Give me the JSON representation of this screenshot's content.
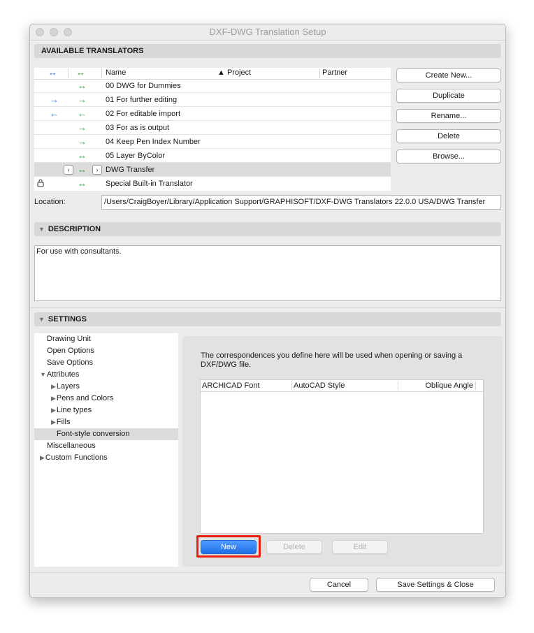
{
  "window": {
    "title": "DXF-DWG Translation Setup"
  },
  "available_translators": {
    "section_label": "AVAILABLE TRANSLATORS",
    "columns": {
      "direction1": "↔",
      "direction2": "↔",
      "name": "Name",
      "project": "▲ Project",
      "partner": "Partner"
    },
    "rows": [
      {
        "name": "00 DWG for Dummies",
        "blue": "",
        "green": "↔"
      },
      {
        "name": "01 For further editing",
        "blue": "→",
        "green": "→"
      },
      {
        "name": "02 For editable import",
        "blue": "←",
        "green": "←"
      },
      {
        "name": "03 For as is output",
        "blue": "",
        "green": "→"
      },
      {
        "name": "04 Keep Pen Index Number",
        "blue": "",
        "green": "→"
      },
      {
        "name": "05 Layer ByColor",
        "blue": "",
        "green": "↔"
      },
      {
        "name": "DWG Transfer",
        "blue": "",
        "green": "↔",
        "selected": true
      },
      {
        "name": "Special Built-in Translator",
        "blue": "",
        "green": "↔",
        "locked": true
      }
    ],
    "buttons": {
      "create_new": "Create New...",
      "duplicate": "Duplicate",
      "rename": "Rename...",
      "delete": "Delete",
      "browse": "Browse..."
    },
    "location_label": "Location:",
    "location_value": "/Users/CraigBoyer/Library/Application Support/GRAPHISOFT/DXF-DWG Translators 22.0.0 USA/DWG Transfer"
  },
  "description": {
    "section_label": "DESCRIPTION",
    "text": "For use with consultants."
  },
  "settings": {
    "section_label": "SETTINGS",
    "tree": [
      {
        "label": "Drawing Unit"
      },
      {
        "label": "Open Options"
      },
      {
        "label": "Save Options"
      },
      {
        "label": "Attributes"
      },
      {
        "label": "Layers"
      },
      {
        "label": "Pens and Colors"
      },
      {
        "label": "Line types"
      },
      {
        "label": "Fills"
      },
      {
        "label": "Font-style conversion"
      },
      {
        "label": "Miscellaneous"
      },
      {
        "label": "Custom Functions"
      }
    ],
    "panel": {
      "message": "The correspondences you define here will be used when opening or saving a DXF/DWG file.",
      "columns": [
        "ARCHICAD Font",
        "AutoCAD Style",
        "Oblique Angle"
      ],
      "buttons": {
        "new": "New",
        "delete": "Delete",
        "edit": "Edit"
      }
    }
  },
  "footer": {
    "cancel": "Cancel",
    "save_close": "Save Settings & Close"
  },
  "colors": {
    "accent_blue": "#1f6fe6",
    "arrow_green": "#27a243",
    "highlight_red": "#e8210a"
  }
}
